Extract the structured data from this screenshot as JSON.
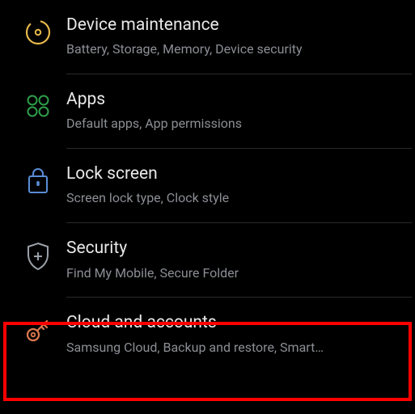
{
  "items": [
    {
      "title": "Device maintenance",
      "subtitle": "Battery, Storage, Memory, Device security"
    },
    {
      "title": "Apps",
      "subtitle": "Default apps, App permissions"
    },
    {
      "title": "Lock screen",
      "subtitle": "Screen lock type, Clock style"
    },
    {
      "title": "Security",
      "subtitle": "Find My Mobile, Secure Folder"
    },
    {
      "title": "Cloud and accounts",
      "subtitle": "Samsung Cloud, Backup and restore, Smart…"
    }
  ],
  "colors": {
    "device_maintenance": "#e6b74a",
    "apps": "#2e9e4a",
    "lock_screen": "#5a8dd6",
    "security": "#9aa0a8",
    "cloud_accounts": "#e07a50"
  }
}
